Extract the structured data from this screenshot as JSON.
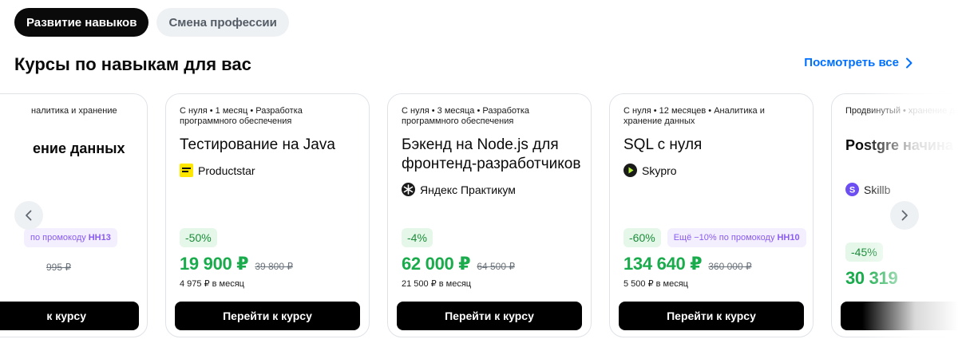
{
  "tabs": [
    {
      "label": "Развитие навыков",
      "active": true
    },
    {
      "label": "Смена профессии",
      "active": false
    }
  ],
  "section": {
    "title": "Курсы по навыкам для вас",
    "see_all": "Посмотреть все"
  },
  "cards": [
    {
      "meta": "налитика и хранение",
      "title": "ение данных",
      "promo_prefix": "по промокоду",
      "promo_code": "HH13",
      "old_price": "995 ₽",
      "cta": "к курсу"
    },
    {
      "meta": "С нуля • 1 месяц • Разработка программного обеспечения",
      "title": "Тестирование на Java",
      "provider": "Productstar",
      "logo_icon": "productstar-logo-icon",
      "discount": "-50%",
      "price": "19 900 ₽",
      "old_price": "39 800 ₽",
      "monthly": "4 975 ₽ в месяц",
      "cta": "Перейти к курсу"
    },
    {
      "meta": "С нуля • 3 месяца • Разработка программного обеспечения",
      "title": "Бэкенд на Node.js для фронтенд-разработчиков",
      "provider": "Яндекс Практикум",
      "logo_icon": "yandex-praktikum-logo-icon",
      "discount": "-4%",
      "price": "62 000 ₽",
      "old_price": "64 500 ₽",
      "monthly": "21 500 ₽ в месяц",
      "cta": "Перейти к курсу"
    },
    {
      "meta": "С нуля • 12 месяцев • Аналитика и хранение данных",
      "title": "SQL с нуля",
      "provider": "Skypro",
      "logo_icon": "skypro-logo-icon",
      "discount": "-60%",
      "promo_prefix": "Ещё −10% по промокоду",
      "promo_code": "HH10",
      "price": "134 640 ₽",
      "old_price": "360 000 ₽",
      "monthly": "5 500 ₽ в месяц",
      "cta": "Перейти к курсу"
    },
    {
      "meta": "Продвинутый • хранение данных",
      "title": "Postgre начина",
      "provider": "Skillb",
      "logo_icon": "skillbox-logo-icon",
      "discount": "-45%",
      "price": "30 319"
    }
  ],
  "colors": {
    "accent_blue": "#0070ff",
    "price_green": "#1aab4c",
    "discount_bg": "#e4f7e8",
    "promo_purple": "#8a5cf0",
    "button_black": "#000000"
  },
  "icons": {
    "prev": "chevron-left-icon",
    "next": "chevron-right-icon",
    "see_all": "chevron-right-icon"
  }
}
